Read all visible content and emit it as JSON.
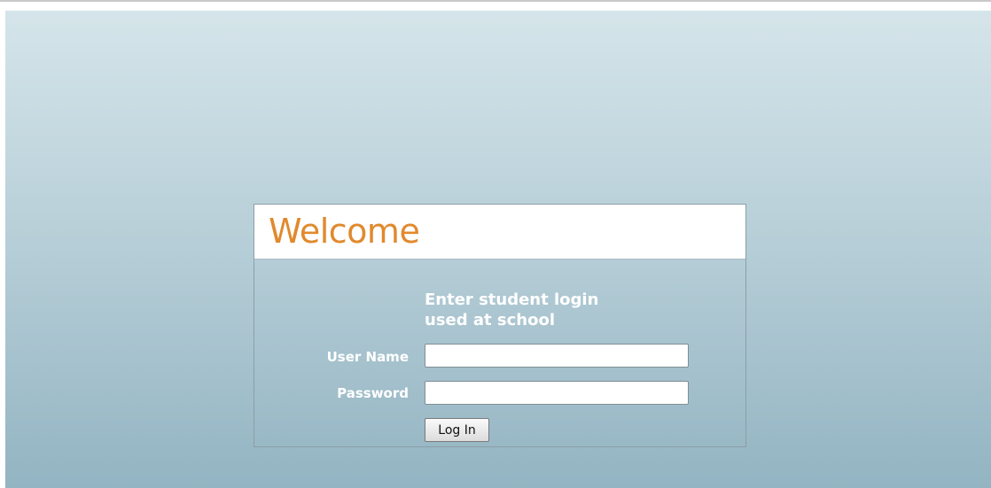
{
  "login": {
    "title": "Welcome",
    "instruction_line1": "Enter student login",
    "instruction_line2": "used at school",
    "username_label": "User Name",
    "username_value": "",
    "password_label": "Password",
    "password_value": "",
    "submit_label": "Log In"
  },
  "colors": {
    "title": "#e08a2e",
    "label_text": "#ffffff",
    "background_top": "#d5e5ea",
    "background_bottom": "#93b4c2"
  }
}
